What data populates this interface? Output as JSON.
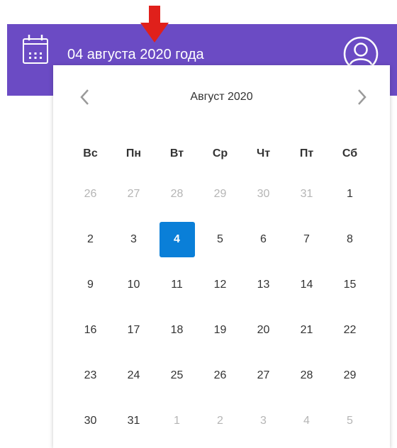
{
  "header": {
    "date_title": "04 августа 2020 года",
    "background_color": "#6b4bc4",
    "icons": [
      "calendar-icon",
      "user-avatar-icon",
      "annotation-arrow"
    ]
  },
  "calendar": {
    "month_title": "Август 2020",
    "prev_icon": "chevron-left-icon",
    "next_icon": "chevron-right-icon",
    "selected_color": "#0a7fd8",
    "weekdays": [
      "Вс",
      "Пн",
      "Вт",
      "Ср",
      "Чт",
      "Пт",
      "Сб"
    ],
    "days": [
      {
        "label": "26",
        "muted": true
      },
      {
        "label": "27",
        "muted": true
      },
      {
        "label": "28",
        "muted": true
      },
      {
        "label": "29",
        "muted": true
      },
      {
        "label": "30",
        "muted": true
      },
      {
        "label": "31",
        "muted": true
      },
      {
        "label": "1",
        "muted": false
      },
      {
        "label": "2",
        "muted": false
      },
      {
        "label": "3",
        "muted": false
      },
      {
        "label": "4",
        "muted": false,
        "selected": true
      },
      {
        "label": "5",
        "muted": false
      },
      {
        "label": "6",
        "muted": false
      },
      {
        "label": "7",
        "muted": false
      },
      {
        "label": "8",
        "muted": false
      },
      {
        "label": "9",
        "muted": false
      },
      {
        "label": "10",
        "muted": false
      },
      {
        "label": "11",
        "muted": false
      },
      {
        "label": "12",
        "muted": false
      },
      {
        "label": "13",
        "muted": false
      },
      {
        "label": "14",
        "muted": false
      },
      {
        "label": "15",
        "muted": false
      },
      {
        "label": "16",
        "muted": false
      },
      {
        "label": "17",
        "muted": false
      },
      {
        "label": "18",
        "muted": false
      },
      {
        "label": "19",
        "muted": false
      },
      {
        "label": "20",
        "muted": false
      },
      {
        "label": "21",
        "muted": false
      },
      {
        "label": "22",
        "muted": false
      },
      {
        "label": "23",
        "muted": false
      },
      {
        "label": "24",
        "muted": false
      },
      {
        "label": "25",
        "muted": false
      },
      {
        "label": "26",
        "muted": false
      },
      {
        "label": "27",
        "muted": false
      },
      {
        "label": "28",
        "muted": false
      },
      {
        "label": "29",
        "muted": false
      },
      {
        "label": "30",
        "muted": false
      },
      {
        "label": "31",
        "muted": false
      },
      {
        "label": "1",
        "muted": true
      },
      {
        "label": "2",
        "muted": true
      },
      {
        "label": "3",
        "muted": true
      },
      {
        "label": "4",
        "muted": true
      },
      {
        "label": "5",
        "muted": true
      }
    ]
  }
}
